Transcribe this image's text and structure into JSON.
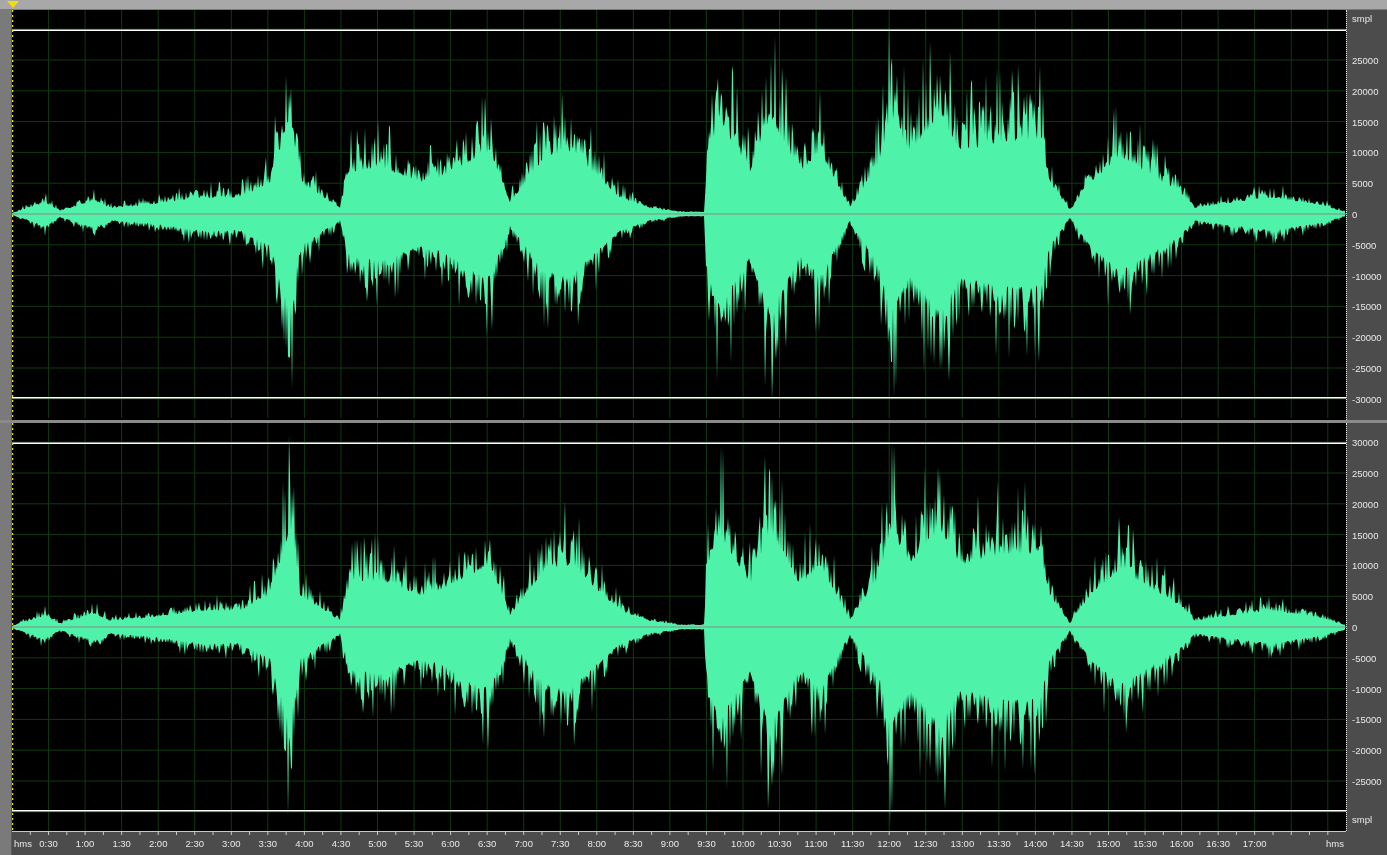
{
  "channels": [
    {
      "unit_label": "smpl",
      "scale_labels": [
        "25000",
        "20000",
        "15000",
        "10000",
        "5000",
        "0",
        "-5000",
        "-10000",
        "-15000",
        "-20000",
        "-25000",
        "-30000"
      ]
    },
    {
      "unit_label": "smpl",
      "scale_labels": [
        "30000",
        "25000",
        "20000",
        "15000",
        "10000",
        "5000",
        "0",
        "-5000",
        "-10000",
        "-15000",
        "-20000",
        "-25000"
      ]
    }
  ],
  "time_ruler": {
    "unit_left": "hms",
    "unit_right": "hms",
    "ticks": [
      "0:30",
      "1:00",
      "1:30",
      "2:00",
      "2:30",
      "3:00",
      "3:30",
      "4:00",
      "4:30",
      "5:00",
      "5:30",
      "6:00",
      "6:30",
      "7:00",
      "7:30",
      "8:00",
      "8:30",
      "9:00",
      "9:30",
      "10:00",
      "10:30",
      "11:00",
      "11:30",
      "12:00",
      "12:30",
      "13:00",
      "13:30",
      "14:00",
      "14:30",
      "15:00",
      "15:30",
      "16:00",
      "16:30",
      "17:00"
    ]
  }
}
